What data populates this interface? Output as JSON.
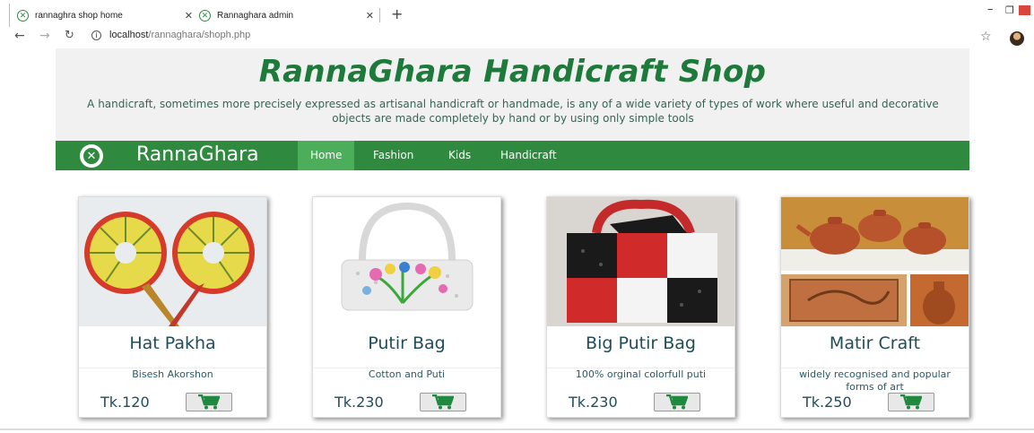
{
  "browser": {
    "tabs": [
      {
        "title": "rannaghra shop home"
      },
      {
        "title": "Rannaghara admin"
      }
    ],
    "new_tab": "+",
    "url_host": "localhost",
    "url_path": "/rannaghara/shoph.php"
  },
  "hero": {
    "title": "RannaGhara Handicraft Shop",
    "description": "A handicraft, sometimes more precisely expressed as artisanal handicraft or handmade, is any of a wide variety of types of work where useful and decorative objects are made completely by hand or by using only simple tools"
  },
  "navbar": {
    "brand": "RannaGhara",
    "links": [
      "Home",
      "Fashion",
      "Kids",
      "Handicraft"
    ],
    "active": "Home"
  },
  "products": [
    {
      "name": "Hat Pakha",
      "description": "Bisesh Akorshon",
      "price": "Tk.120",
      "image": "hand-fan"
    },
    {
      "name": "Putir Bag",
      "description": "Cotton and Puti",
      "price": "Tk.230",
      "image": "bead-bag-white"
    },
    {
      "name": "Big Putir Bag",
      "description": "100% orginal colorfull puti",
      "price": "Tk.230",
      "image": "bead-bag-checkered"
    },
    {
      "name": "Matir Craft",
      "description": "widely recognised and popular forms of art",
      "price": "Tk.250",
      "image": "clay-teapots"
    }
  ],
  "colors": {
    "brand_green": "#2f8a3f",
    "active_green": "#4cae5a",
    "title_green": "#1e7a3a",
    "cart_icon": "#1f8a3f"
  }
}
